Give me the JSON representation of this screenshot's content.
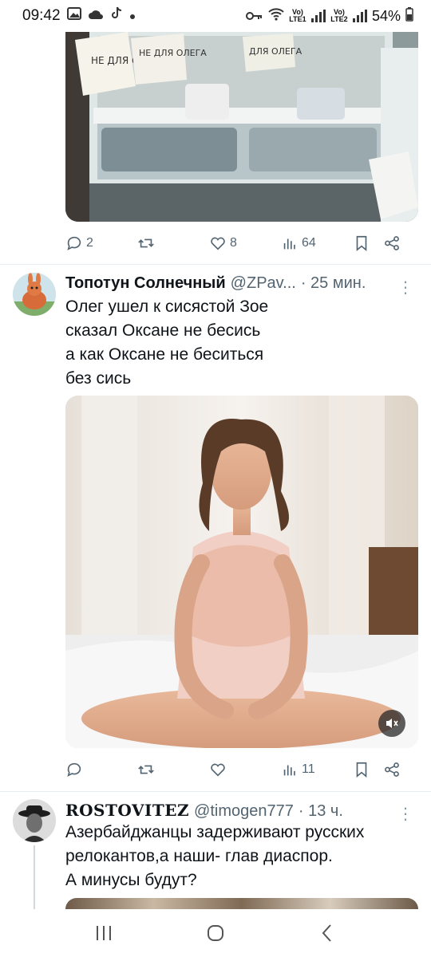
{
  "status": {
    "time": "09:42",
    "battery": "54%",
    "sim1": "Vo) LTE1",
    "sim2": "Vo) LTE2",
    "left_icons": [
      "gallery-icon",
      "cloud-icon",
      "tiktok-icon",
      "dot-icon"
    ],
    "right_icons": [
      "key-icon",
      "wifi-icon",
      "signal-icon",
      "signal-icon",
      "battery-icon"
    ]
  },
  "tweet1": {
    "media_labels": [
      "НЕ ДЛЯ ОЛЕГА",
      "НЕ ДЛЯ ОЛЕГА",
      "ДЛЯ ОЛЕГА",
      "ОЛЕГА",
      "ДЛЯ ОЛЕГА"
    ],
    "replies": "2",
    "retweets": "",
    "likes": "8",
    "views": "64"
  },
  "tweet2": {
    "name": "Топотун Солнечный",
    "handle": "@ZPav...",
    "time": "· 25 мин.",
    "text_lines": [
      "Олег ушел к сисястой Зое",
      "сказал Оксане не бесись",
      "а как Оксане не беситься",
      "без сись"
    ],
    "replies": "",
    "retweets": "",
    "likes": "",
    "views": "11"
  },
  "tweet3": {
    "name": "ROSTOVITEZ",
    "handle": "@timogen777",
    "time": "· 13 ч.",
    "text_lines": [
      "Азербайджанцы задерживают русских",
      "релокантов,а наши- глав диаспор.",
      "А минусы будут?"
    ]
  },
  "colors": {
    "text": "#0f1419",
    "secondary": "#536471",
    "divider": "#e6ecf0"
  }
}
